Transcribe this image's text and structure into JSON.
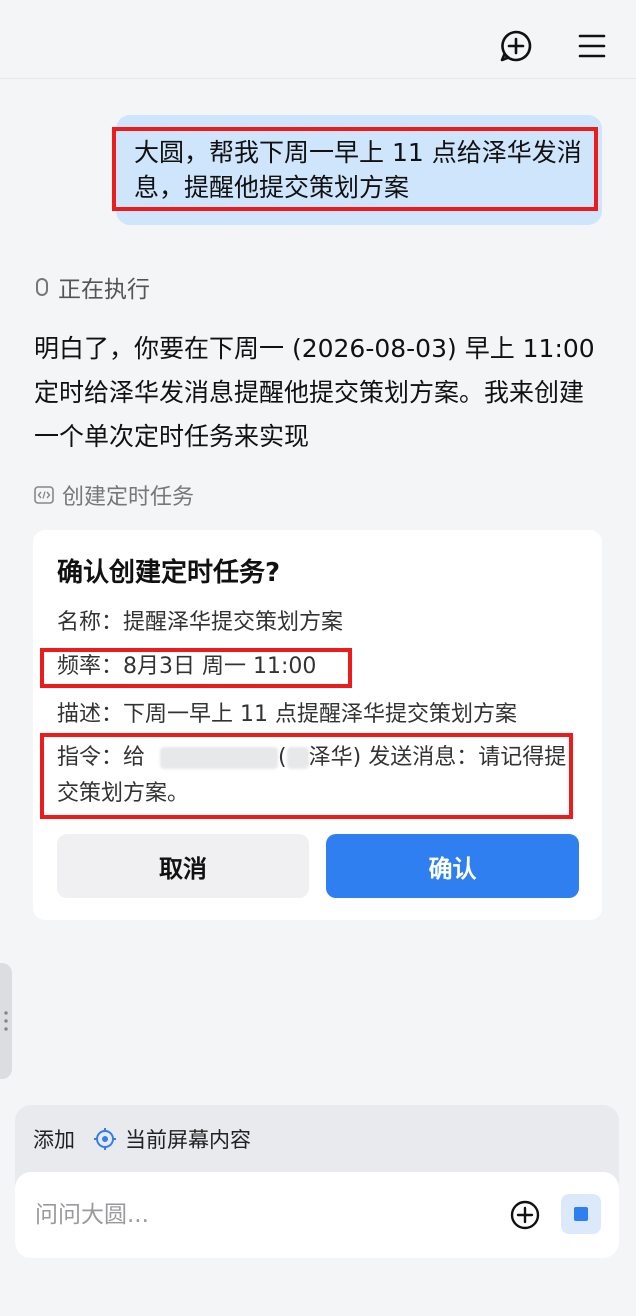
{
  "header": {
    "new_chat_icon": "chat-plus-icon",
    "menu_icon": "hamburger-menu-icon"
  },
  "user_message": {
    "text": "大圆，帮我下周一早上 11 点给泽华发消息，提醒他提交策划方案"
  },
  "assistant": {
    "status": "正在执行",
    "reply": "明白了，你要在下周一 (2026-08-03) 早上 11:00 定时给泽华发消息提醒他提交策划方案。我来创建一个单次定时任务来实现",
    "tool_label": "创建定时任务"
  },
  "confirm_card": {
    "title": "确认创建定时任务?",
    "name_label": "名称：",
    "name_value": "提醒泽华提交策划方案",
    "freq_label": "频率：",
    "freq_value": "8月3日 周一 11:00",
    "desc_label": "描述：",
    "desc_value": "下周一早上 11 点提醒泽华提交策划方案",
    "cmd_label": "指令：",
    "cmd_prefix": "给",
    "cmd_open": "(",
    "cmd_name": "泽华",
    "cmd_suffix": ") 发送消息：请记得提交策划方案。",
    "cancel_label": "取消",
    "confirm_label": "确认"
  },
  "composer": {
    "add_label": "添加",
    "screen_context_label": "当前屏幕内容",
    "placeholder": "问问大圆...",
    "accent": "#2f7ff0"
  },
  "highlight_color": "#ec1c1c"
}
